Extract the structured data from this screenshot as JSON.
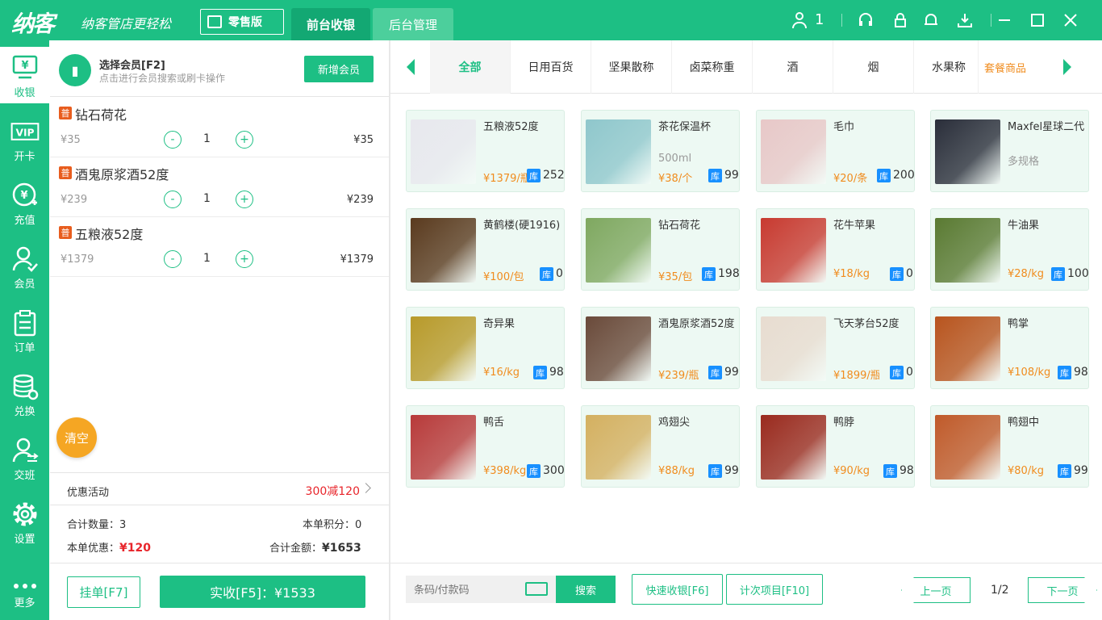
{
  "app": {
    "logo": "纳客",
    "slogan": "纳客管店更轻松",
    "edition": "零售版",
    "user_count": "1"
  },
  "tabs": [
    {
      "label": "前台收银"
    },
    {
      "label": "后台管理"
    }
  ],
  "sidebar": [
    {
      "label": "收银",
      "icon": "yen-screen-icon"
    },
    {
      "label": "开卡",
      "icon": "vip-icon"
    },
    {
      "label": "充值",
      "icon": "recharge-icon"
    },
    {
      "label": "会员",
      "icon": "member-icon"
    },
    {
      "label": "订单",
      "icon": "order-icon"
    },
    {
      "label": "兑换",
      "icon": "coins-icon"
    },
    {
      "label": "交班",
      "icon": "handover-icon"
    },
    {
      "label": "设置",
      "icon": "gear-icon"
    },
    {
      "label": "更多",
      "icon": "more-icon"
    }
  ],
  "member": {
    "title": "选择会员[F2]",
    "hint": "点击进行会员搜索或刷卡操作",
    "new_button": "新增会员"
  },
  "cart": [
    {
      "badge": "普",
      "name": "钻石荷花",
      "unit_price": "¥35",
      "qty": "1",
      "total": "¥35"
    },
    {
      "badge": "普",
      "name": "酒鬼原浆酒52度",
      "unit_price": "¥239",
      "qty": "1",
      "total": "¥239"
    },
    {
      "badge": "普",
      "name": "五粮液52度",
      "unit_price": "¥1379",
      "qty": "1",
      "total": "¥1379"
    }
  ],
  "clear_label": "清空",
  "promo": {
    "label": "优惠活动",
    "value": "300减120"
  },
  "summary": {
    "qty_label": "合计数量：",
    "qty": "3",
    "points_label": "本单积分：",
    "points": "0",
    "discount_label": "本单优惠：",
    "discount": "¥120",
    "amount_label": "合计金额：",
    "amount": "¥1653"
  },
  "actions": {
    "hold": "挂单[F7]",
    "pay": "实收[F5]：¥1533"
  },
  "categories": [
    "全部",
    "日用百货",
    "坚果散称",
    "卤菜称重",
    "酒",
    "烟",
    "水果称"
  ],
  "combo_label": "套餐商品",
  "products": [
    {
      "name": "五粮液52度",
      "spec": "",
      "price": "¥1379/瓶",
      "stock": "252",
      "color": "#e8e8ee"
    },
    {
      "name": "茶花保温杯",
      "spec": "500ml",
      "price": "¥38/个",
      "stock": "99",
      "color": "#8fc7cc"
    },
    {
      "name": "毛巾",
      "spec": "",
      "price": "¥20/条",
      "stock": "200",
      "color": "#e8c8c8"
    },
    {
      "name": "Maxfel星球二代",
      "spec": "多规格",
      "price": "",
      "stock": "",
      "color": "#2a2e3a"
    },
    {
      "name": "黄鹤楼(硬1916)",
      "spec": "",
      "price": "¥100/包",
      "stock": "0",
      "color": "#5a3a1e"
    },
    {
      "name": "钻石荷花",
      "spec": "",
      "price": "¥35/包",
      "stock": "198",
      "color": "#7fa860"
    },
    {
      "name": "花牛苹果",
      "spec": "",
      "price": "¥18/kg",
      "stock": "0",
      "color": "#c83a30"
    },
    {
      "name": "牛油果",
      "spec": "",
      "price": "¥28/kg",
      "stock": "100",
      "color": "#5a7a32"
    },
    {
      "name": "奇异果",
      "spec": "",
      "price": "¥16/kg",
      "stock": "98",
      "color": "#b89a2a"
    },
    {
      "name": "酒鬼原浆酒52度",
      "spec": "",
      "price": "¥239/瓶",
      "stock": "99",
      "color": "#6a4a3a"
    },
    {
      "name": "飞天茅台52度",
      "spec": "",
      "price": "¥1899/瓶",
      "stock": "0",
      "color": "#e8dcd0"
    },
    {
      "name": "鸭掌",
      "spec": "",
      "price": "¥108/kg",
      "stock": "98",
      "color": "#b8541e"
    },
    {
      "name": "鸭舌",
      "spec": "",
      "price": "¥398/kg",
      "stock": "300",
      "color": "#b83a3a"
    },
    {
      "name": "鸡翅尖",
      "spec": "",
      "price": "¥88/kg",
      "stock": "99",
      "color": "#d4b060"
    },
    {
      "name": "鸭脖",
      "spec": "",
      "price": "¥90/kg",
      "stock": "98",
      "color": "#9a2a1e"
    },
    {
      "name": "鸭翅中",
      "spec": "",
      "price": "¥80/kg",
      "stock": "99",
      "color": "#c05a2a"
    }
  ],
  "stock_badge": "库",
  "search": {
    "placeholder": "条码/付款码",
    "button": "搜索"
  },
  "quick_pay": "快速收银[F6]",
  "count_items": "计次项目[F10]",
  "pager": {
    "prev": "上一页",
    "page": "1/2",
    "next": "下一页"
  }
}
